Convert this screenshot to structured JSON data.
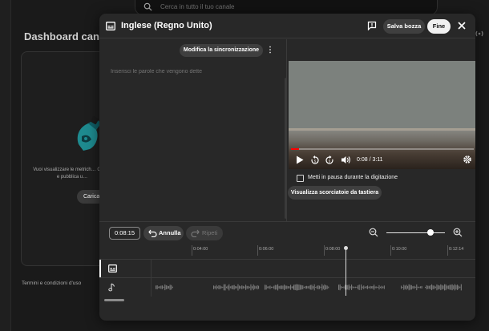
{
  "background": {
    "search_placeholder": "Cerca in tutto il tuo canale",
    "page_title": "Dashboard canale",
    "card_text": "Vuoi visualizzare le metrich… Carica e pubblica u…",
    "upload_label": "Carica",
    "terms": "Termini e condizioni d'uso"
  },
  "dialog": {
    "title": "Inglese (Regno Unito)",
    "save_draft": "Salva bozza",
    "done": "Fine",
    "edit_sync": "Modifica la sincronizzazione",
    "input_placeholder": "Inserisci le parole che vengono dette",
    "player": {
      "time": "0:08 / 3:11",
      "progress": 0.042
    },
    "pause_while_typing": "Metti in pausa durante la digitazione",
    "pause_checked": false,
    "shortcuts": "Visualizza scorciatoie da tastiera"
  },
  "timeline": {
    "timecode": "0:08:15",
    "undo": "Annulla",
    "redo": "Ripeti",
    "zoom_level": 0.75,
    "ticks": [
      "0:04:00",
      "0:06:00",
      "0:08:00",
      "0:10:00",
      "0:12:14"
    ]
  },
  "colors": {
    "accent_progress": "#ff0000",
    "dialog_bg": "#282828"
  }
}
